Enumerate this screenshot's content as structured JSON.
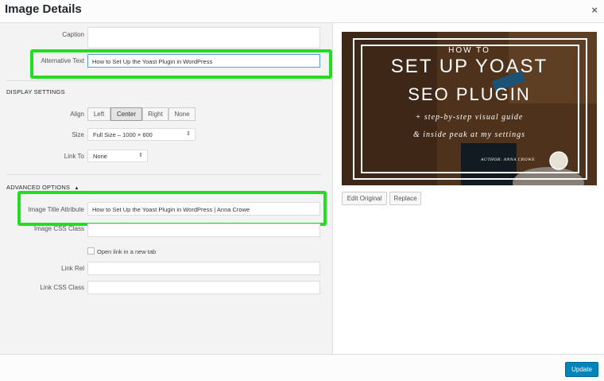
{
  "dialog": {
    "title": "Image Details",
    "close_label": "×"
  },
  "fields": {
    "caption_label": "Caption",
    "caption_value": "",
    "alt_label": "Alternative Text",
    "alt_value": "How to Set Up the Yoast Plugin in WordPress",
    "display_heading": "DISPLAY SETTINGS",
    "align_label": "Align",
    "align_options": [
      "Left",
      "Center",
      "Right",
      "None"
    ],
    "align_selected": "Center",
    "size_label": "Size",
    "size_value": "Full Size – 1000 × 600",
    "linkto_label": "Link To",
    "linkto_value": "None",
    "advanced_heading": "ADVANCED OPTIONS",
    "advanced_toggle": "▲",
    "title_attr_label": "Image Title Attribute",
    "title_attr_value": "How to Set Up the Yoast Plugin in WordPress | Anna Crowe",
    "css_class_label": "Image CSS Class",
    "css_class_value": "",
    "new_tab_label": "Open link in a new tab",
    "link_rel_label": "Link Rel",
    "link_rel_value": "",
    "link_css_label": "Link CSS Class",
    "link_css_value": ""
  },
  "image": {
    "line1": "HOW TO",
    "line2": "SET UP YOAST",
    "line3": "SEO PLUGIN",
    "line4": "+ step-by-step visual guide",
    "line5": "& inside peak at my settings",
    "author": "AUTHOR: ANNA CROWE"
  },
  "buttons": {
    "edit_original": "Edit Original",
    "replace": "Replace",
    "update": "Update"
  },
  "colors": {
    "highlight": "#22dd22",
    "primary": "#0085ba"
  }
}
